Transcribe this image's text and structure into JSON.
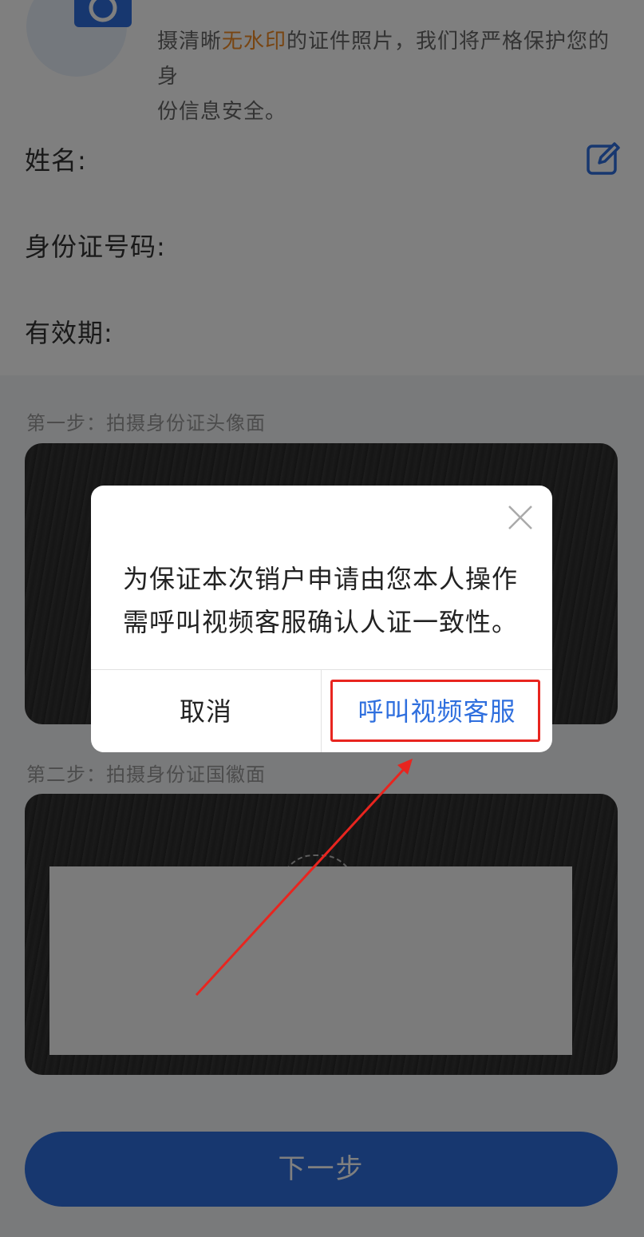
{
  "tip": {
    "line2_pre": "摄清晰",
    "line2_highlight": "无水印",
    "line2_post": "的证件照片，我们将严格保护您的身",
    "line3": "份信息安全。"
  },
  "form": {
    "name_label": "姓名:",
    "id_label": "身份证号码:",
    "validity_label": "有效期:"
  },
  "steps": {
    "step1": "第一步：拍摄身份证头像面",
    "step2": "第二步：拍摄身份证国徽面"
  },
  "next_button": "下一步",
  "dialog": {
    "message_line1": "为保证本次销户申请由您本人操作",
    "message_line2": "需呼叫视频客服确认人证一致性。",
    "cancel": "取消",
    "confirm": "呼叫视频客服"
  },
  "colors": {
    "accent": "#2f6fde",
    "highlight": "#f08a24",
    "annotation": "#e8251f"
  }
}
